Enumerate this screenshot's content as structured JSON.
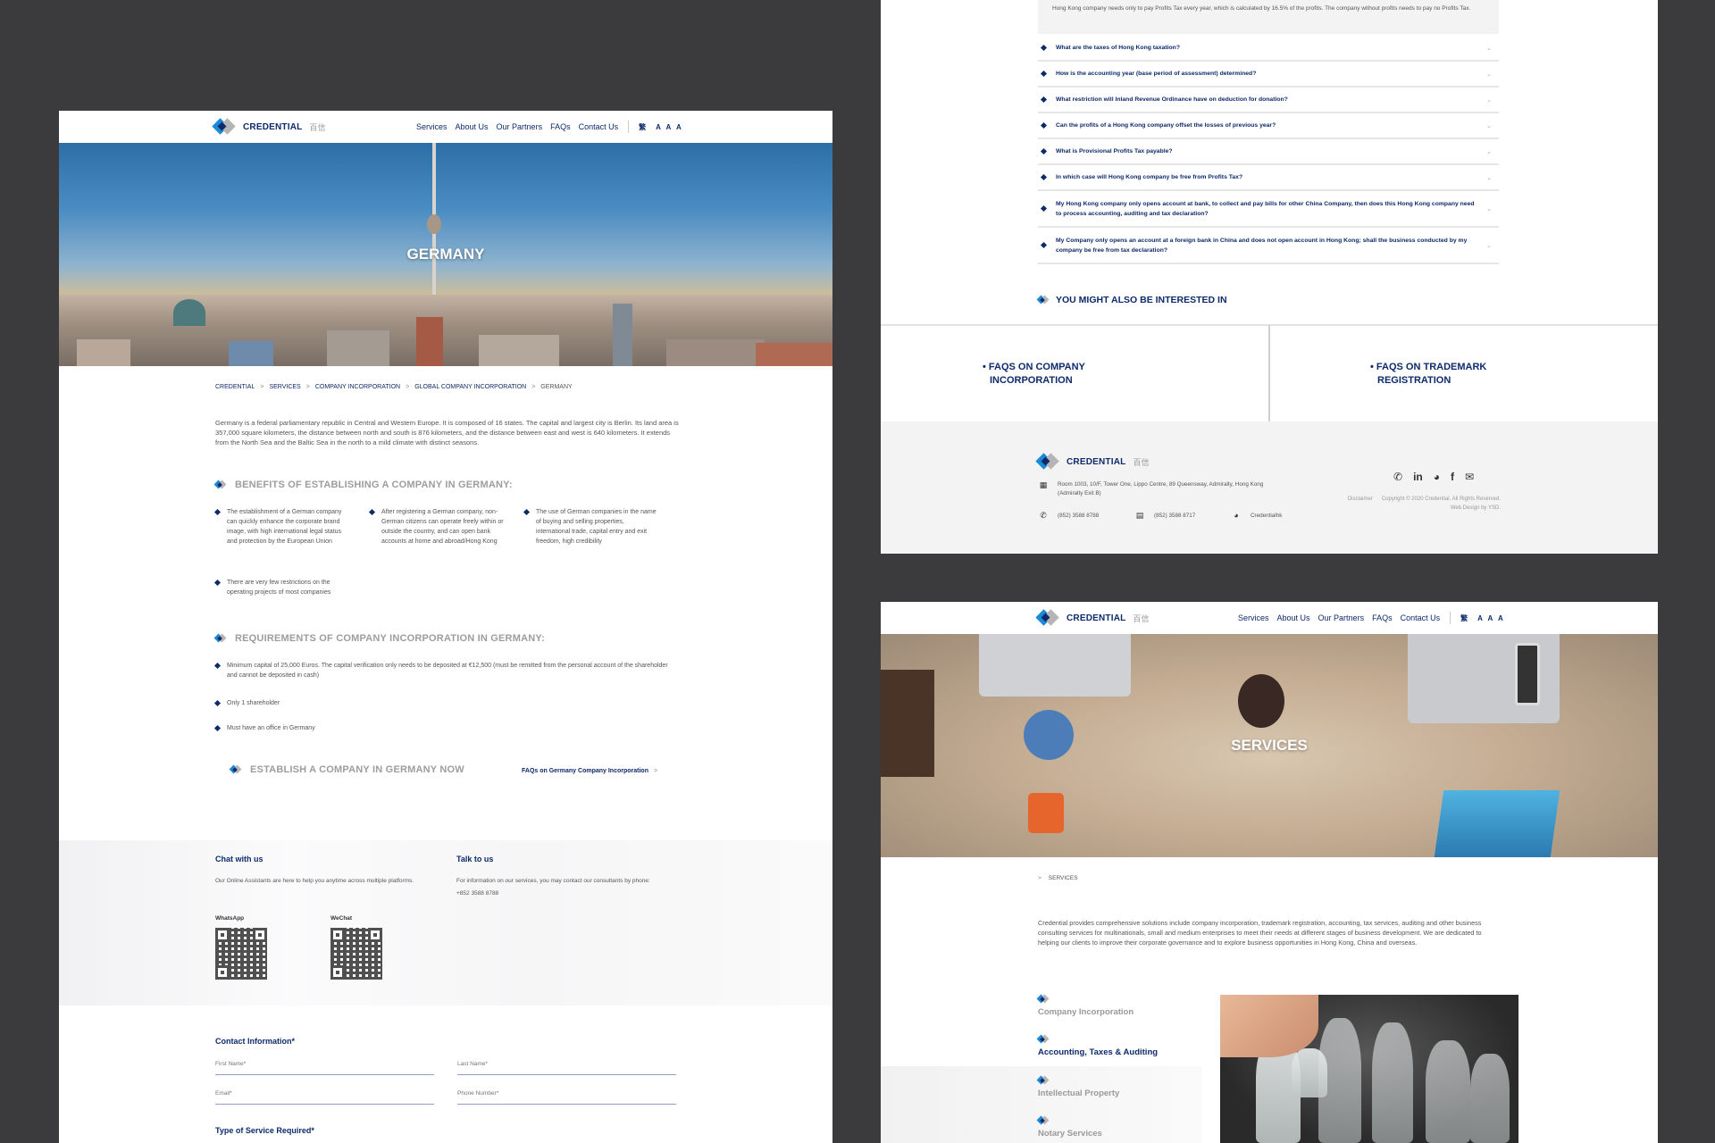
{
  "brand": {
    "name": "CREDENTIAL",
    "chinese_name": "百信",
    "colors": {
      "navy": "#0d2a6b",
      "blue": "#1a8ad8",
      "grey": "#b5b5b8",
      "backdrop": "#3b3b3d"
    }
  },
  "nav": {
    "items": [
      "Services",
      "About Us",
      "Our Partners",
      "FAQs",
      "Contact Us"
    ],
    "lang_toggle": "繁",
    "font_sizes": "A A A"
  },
  "germany_page": {
    "hero_title": "GERMANY",
    "breadcrumb": [
      "CREDENTIAL",
      "SERVICES",
      "COMPANY INCORPORATION",
      "GLOBAL COMPANY INCORPORATION",
      "GERMANY"
    ],
    "breadcrumb_separator": ">",
    "intro": "Germany is a federal parliamentary republic in Central and Western Europe. It is composed of 16 states. The capital and largest city is Berlin. Its land area is 357,000 square kilometers, the distance between north and south is 876 kilometers, and the distance between east and west is 640 kilometers. It extends from the North Sea and the Baltic Sea in the north to a mild climate with distinct seasons.",
    "benefits_title": "BENEFITS OF ESTABLISHING A COMPANY IN GERMANY:",
    "benefits": [
      "The establishment of a German company can quickly enhance the corporate brand image, with high international legal status and protection by the European Union",
      "After registering a German company, non-German citizens can operate freely within or outside the country, and can open bank accounts at home and abroad/Hong Kong",
      "The use of German companies in the name of buying and selling properties, international trade, capital entry and exit freedom, high credibility",
      "There are very few restrictions on the operating projects of most companies"
    ],
    "requirements_title": "REQUIREMENTS OF COMPANY INCORPORATION IN GERMANY:",
    "requirements": [
      "Minimum capital of 25,000 Euros. The capital verification only needs to be deposited at €12,500 (must be remitted from the personal account of the shareholder and cannot be deposited in cash)",
      "Only 1 shareholder",
      "Must have an office in Germany"
    ],
    "cta_title": "ESTABLISH A COMPANY IN GERMANY NOW",
    "faq_link": "FAQs on Germany Company Incorporation",
    "faq_link_chevron": ">",
    "chat": {
      "title": "Chat with us",
      "text": "Our Online Assistants are here to help you anytime across multiple platforms.",
      "whatsapp_label": "WhatsApp",
      "wechat_label": "WeChat"
    },
    "talk": {
      "title": "Talk to us",
      "text": "For information on our services, you may contact our consultants by phone:",
      "phone": "+852 3588 8788"
    },
    "form": {
      "contact_title": "Contact Information*",
      "first_name_placeholder": "First Name*",
      "last_name_placeholder": "Last Name*",
      "email_placeholder": "Email*",
      "phone_placeholder": "Phone Number*",
      "service_title": "Type of Service Required*"
    }
  },
  "faq_page": {
    "open_answer": "Hong Kong company needs only to pay Profits Tax every year, which is calculated by 16.5% of the profits. The company without profits needs to pay no Profits Tax.",
    "questions": [
      "What are the taxes of Hong Kong taxation?",
      "How is the accounting year (base period of assessment) determined?",
      "What restriction will Inland Revenue Ordinance have on deduction for donation?",
      "Can the profits of a Hong Kong company offset the losses of previous year?",
      "What is Provisional Profits Tax payable?",
      "In which case will Hong Kong company be free from Profits Tax?",
      "My Hong Kong company only opens account at bank, to collect and pay bills for other China Company, then does this Hong Kong company need to process accounting, auditing and tax declaration?",
      "My Company only opens an account at a foreign bank in China and does not open account in Hong Kong; shall the business conducted by my company be free from tax declaration?"
    ],
    "chevron": "⌄",
    "interested_title": "YOU MIGHT ALSO BE INTERESTED IN",
    "cards": [
      {
        "line1": "• FAQS ON COMPANY",
        "line2": "INCORPORATION"
      },
      {
        "line1": "• FAQS ON TRADEMARK",
        "line2": "REGISTRATION"
      }
    ]
  },
  "footer": {
    "address_line1": "Room 1003, 10/F, Tower One, Lippo Centre, 89 Queensway, Admiralty, Hong Kong",
    "address_line2": "(Admiralty Exit B)",
    "phone": "(852) 3588 8788",
    "fax": "(852) 3588 8717",
    "wechat_id": "Credentialhk",
    "social_icons": [
      "whatsapp-icon",
      "linkedin-icon",
      "wechat-icon",
      "facebook-icon",
      "email-icon"
    ],
    "social_glyphs": [
      "✆",
      "in",
      "◕",
      "f",
      "✉"
    ],
    "disclaimer": "Disclaimer",
    "copyright": "Copyright © 2020 Credential. All Rights Reserved.",
    "web_design": "Web Design by YSD."
  },
  "services_page": {
    "hero_title": "SERVICES",
    "breadcrumb_chevron": ">",
    "breadcrumb": "SERVICES",
    "intro": "Credential provides comprehensive solutions include company incorporation, trademark registration, accounting, tax services, auditing and other business consulting services for multinationals, small and medium enterprises to meet their needs at different stages of business development. We are dedicated to helping our clients to improve their corporate governance and to explore business opportunities in Hong Kong, China and overseas.",
    "service_items": [
      {
        "label": "Company Incorporation",
        "active": false
      },
      {
        "label": "Accounting, Taxes & Auditing",
        "active": true
      },
      {
        "label": "Intellectual Property",
        "active": false
      },
      {
        "label": "Notary Services",
        "active": false
      }
    ]
  }
}
